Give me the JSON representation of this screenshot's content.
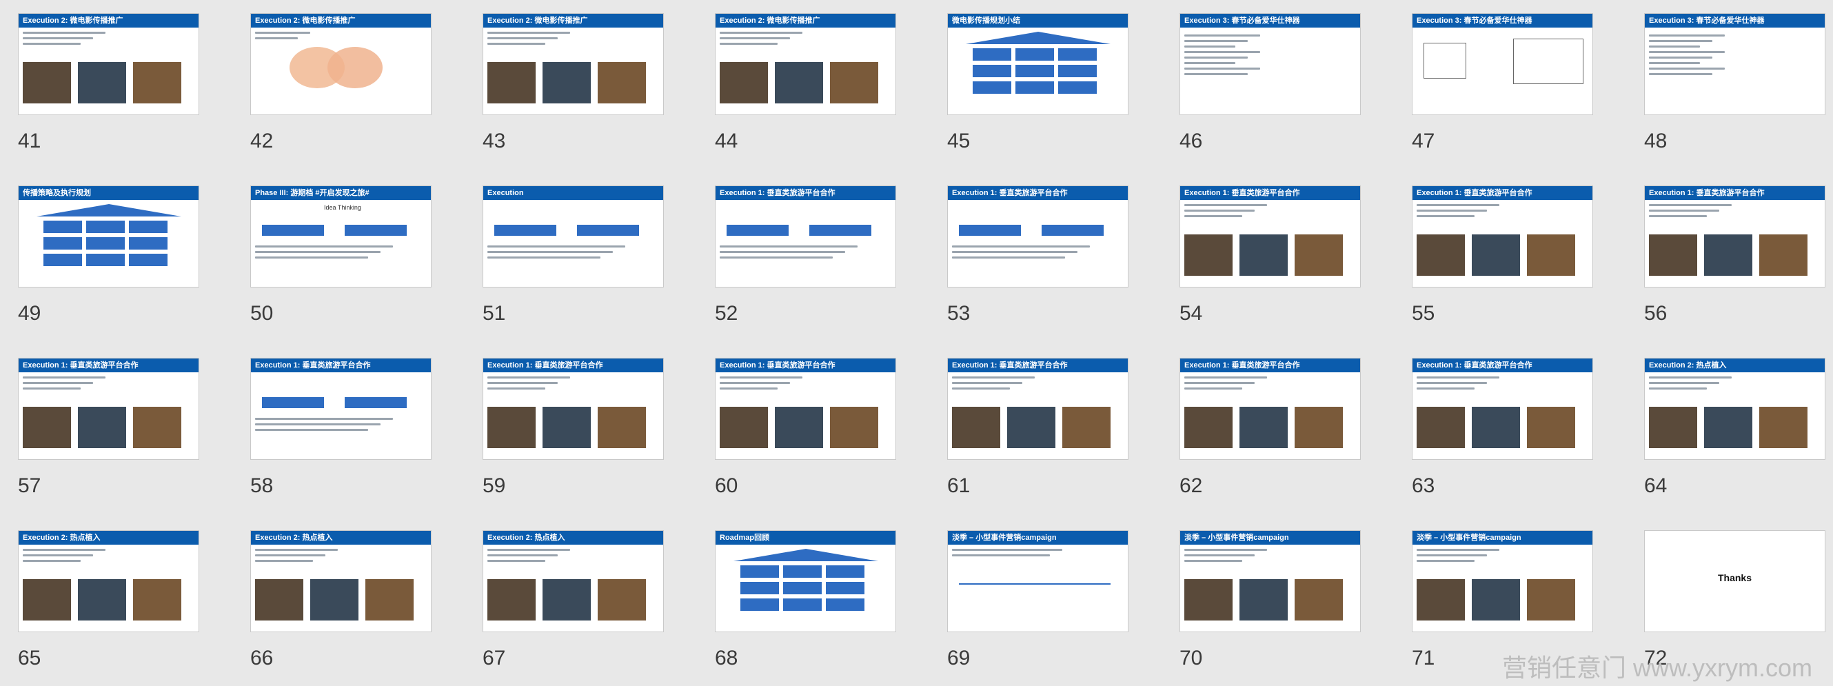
{
  "slides": [
    {
      "number": "41",
      "title": "Execution 2: 微电影传播推广",
      "kind": "photos"
    },
    {
      "number": "42",
      "title": "Execution 2: 微电影传播推广",
      "kind": "venn"
    },
    {
      "number": "43",
      "title": "Execution 2: 微电影传播推广",
      "kind": "photos"
    },
    {
      "number": "44",
      "title": "Execution 2: 微电影传播推广",
      "kind": "photos"
    },
    {
      "number": "45",
      "title": "微电影传播规划小结",
      "kind": "diagram"
    },
    {
      "number": "46",
      "title": "Execution 3: 春节必备爱华仕神器",
      "kind": "text"
    },
    {
      "number": "47",
      "title": "Execution 3: 春节必备爱华仕神器",
      "kind": "arrow"
    },
    {
      "number": "48",
      "title": "Execution 3: 春节必备爱华仕神器",
      "kind": "text"
    },
    {
      "number": "49",
      "title": "传播策略及执行规划",
      "kind": "diagram"
    },
    {
      "number": "50",
      "title": "Phase III: 游期档 #开启发现之旅#",
      "kind": "boxes",
      "subtitle": "Idea Thinking"
    },
    {
      "number": "51",
      "title": "Execution",
      "kind": "boxes"
    },
    {
      "number": "52",
      "title": "Execution 1: 垂直类旅游平台合作",
      "kind": "boxes"
    },
    {
      "number": "53",
      "title": "Execution 1: 垂直类旅游平台合作",
      "kind": "boxes"
    },
    {
      "number": "54",
      "title": "Execution 1: 垂直类旅游平台合作",
      "kind": "photos"
    },
    {
      "number": "55",
      "title": "Execution 1: 垂直类旅游平台合作",
      "kind": "photos"
    },
    {
      "number": "56",
      "title": "Execution 1: 垂直类旅游平台合作",
      "kind": "photos"
    },
    {
      "number": "57",
      "title": "Execution 1: 垂直类旅游平台合作",
      "kind": "photos"
    },
    {
      "number": "58",
      "title": "Execution 1: 垂直类旅游平台合作",
      "kind": "boxes"
    },
    {
      "number": "59",
      "title": "Execution 1: 垂直类旅游平台合作",
      "kind": "photos"
    },
    {
      "number": "60",
      "title": "Execution 1: 垂直类旅游平台合作",
      "kind": "photos"
    },
    {
      "number": "61",
      "title": "Execution 1: 垂直类旅游平台合作",
      "kind": "photos"
    },
    {
      "number": "62",
      "title": "Execution 1: 垂直类旅游平台合作",
      "kind": "photos"
    },
    {
      "number": "63",
      "title": "Execution 1: 垂直类旅游平台合作",
      "kind": "photos"
    },
    {
      "number": "64",
      "title": "Execution 2: 热点植入",
      "kind": "photos"
    },
    {
      "number": "65",
      "title": "Execution 2: 热点植入",
      "kind": "photos"
    },
    {
      "number": "66",
      "title": "Execution 2: 热点植入",
      "kind": "photos"
    },
    {
      "number": "67",
      "title": "Execution 2: 热点植入",
      "kind": "photos"
    },
    {
      "number": "68",
      "title": "Roadmap回顾",
      "kind": "diagram"
    },
    {
      "number": "69",
      "title": "淡季 – 小型事件营销campaign",
      "kind": "timeline"
    },
    {
      "number": "70",
      "title": "淡季 – 小型事件营销campaign",
      "kind": "photos"
    },
    {
      "number": "71",
      "title": "淡季 – 小型事件营销campaign",
      "kind": "photos"
    },
    {
      "number": "72",
      "title": "",
      "kind": "thanks",
      "thanks_text": "Thanks"
    }
  ],
  "watermark": "营销任意门 www.yxrym.com",
  "colors": {
    "bar": "#0b5cad",
    "box": "#2e6cc2",
    "bg": "#e8e8e8"
  }
}
